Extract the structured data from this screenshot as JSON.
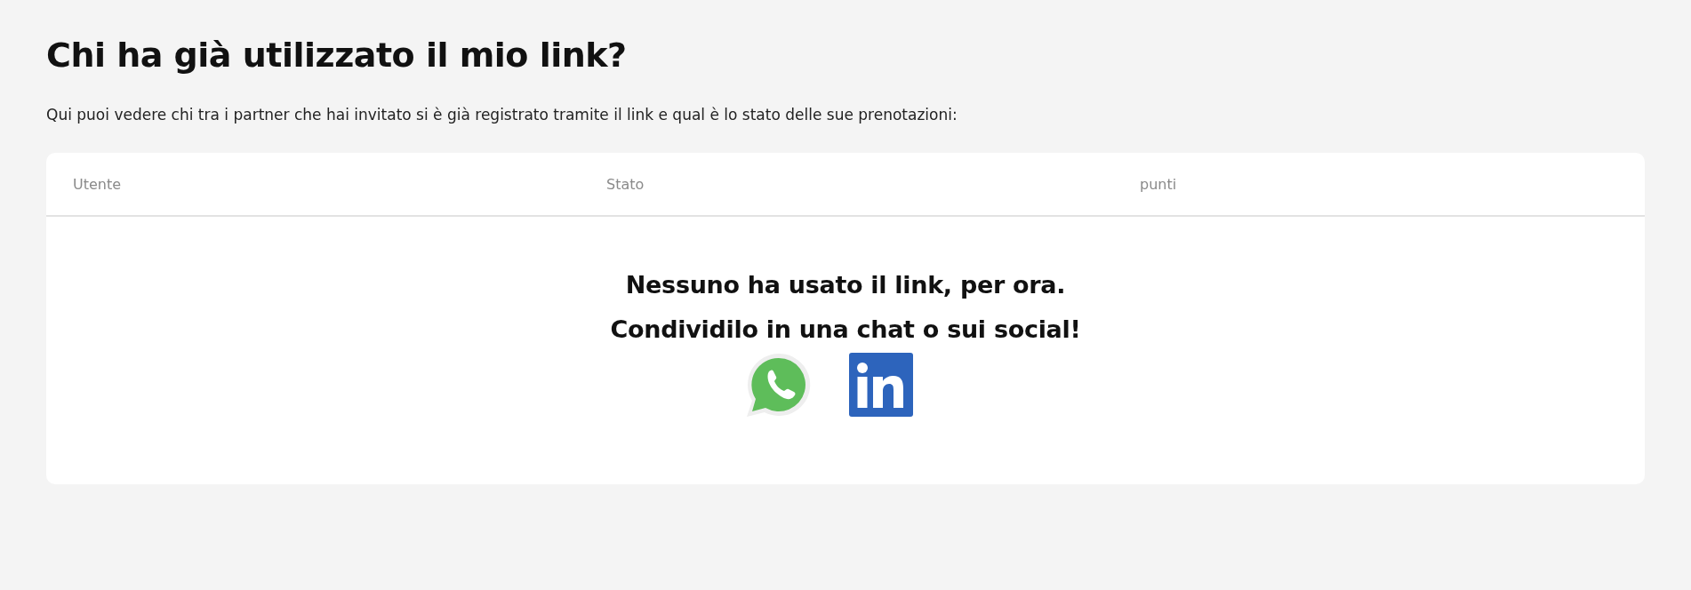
{
  "title": "Chi ha già utilizzato il mio link?",
  "intro": "Qui puoi vedere chi tra i partner che hai invitato si è già registrato tramite il link e qual è lo stato delle sue prenotazioni:",
  "table": {
    "columns": [
      "Utente",
      "Stato",
      "punti"
    ],
    "empty_state": {
      "lines": [
        "Nessuno ha usato il link, per ora.",
        "Condividilo in una chat o sui social!"
      ]
    },
    "share_buttons": [
      {
        "kind": "whatsapp"
      },
      {
        "kind": "linkedin"
      }
    ]
  }
}
